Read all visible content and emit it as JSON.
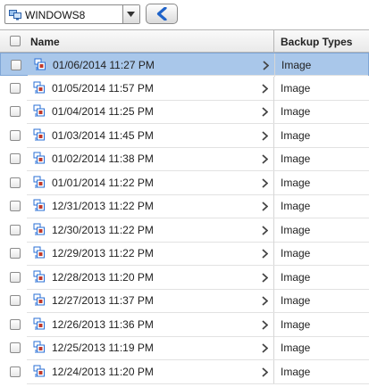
{
  "toolbar": {
    "machine_selector": {
      "value": "WINDOWS8",
      "icon": "computer-icon"
    },
    "back_button": {
      "icon": "back-arrow-icon"
    }
  },
  "grid": {
    "columns": {
      "name": "Name",
      "type": "Backup Types"
    },
    "colors": {
      "selected_row": "#a9c7ea",
      "icon_blue": "#2a6fd6",
      "icon_red": "#c0392b"
    },
    "rows": [
      {
        "name": "01/06/2014 11:27 PM",
        "type": "Image",
        "selected": true
      },
      {
        "name": "01/05/2014 11:57 PM",
        "type": "Image"
      },
      {
        "name": "01/04/2014 11:25 PM",
        "type": "Image"
      },
      {
        "name": "01/03/2014 11:45 PM",
        "type": "Image"
      },
      {
        "name": "01/02/2014 11:38 PM",
        "type": "Image"
      },
      {
        "name": "01/01/2014 11:22 PM",
        "type": "Image"
      },
      {
        "name": "12/31/2013 11:22 PM",
        "type": "Image"
      },
      {
        "name": "12/30/2013 11:22 PM",
        "type": "Image"
      },
      {
        "name": "12/29/2013 11:22 PM",
        "type": "Image"
      },
      {
        "name": "12/28/2013 11:20 PM",
        "type": "Image"
      },
      {
        "name": "12/27/2013 11:37 PM",
        "type": "Image"
      },
      {
        "name": "12/26/2013 11:36 PM",
        "type": "Image"
      },
      {
        "name": "12/25/2013 11:19 PM",
        "type": "Image"
      },
      {
        "name": "12/24/2013 11:20 PM",
        "type": "Image"
      }
    ]
  }
}
